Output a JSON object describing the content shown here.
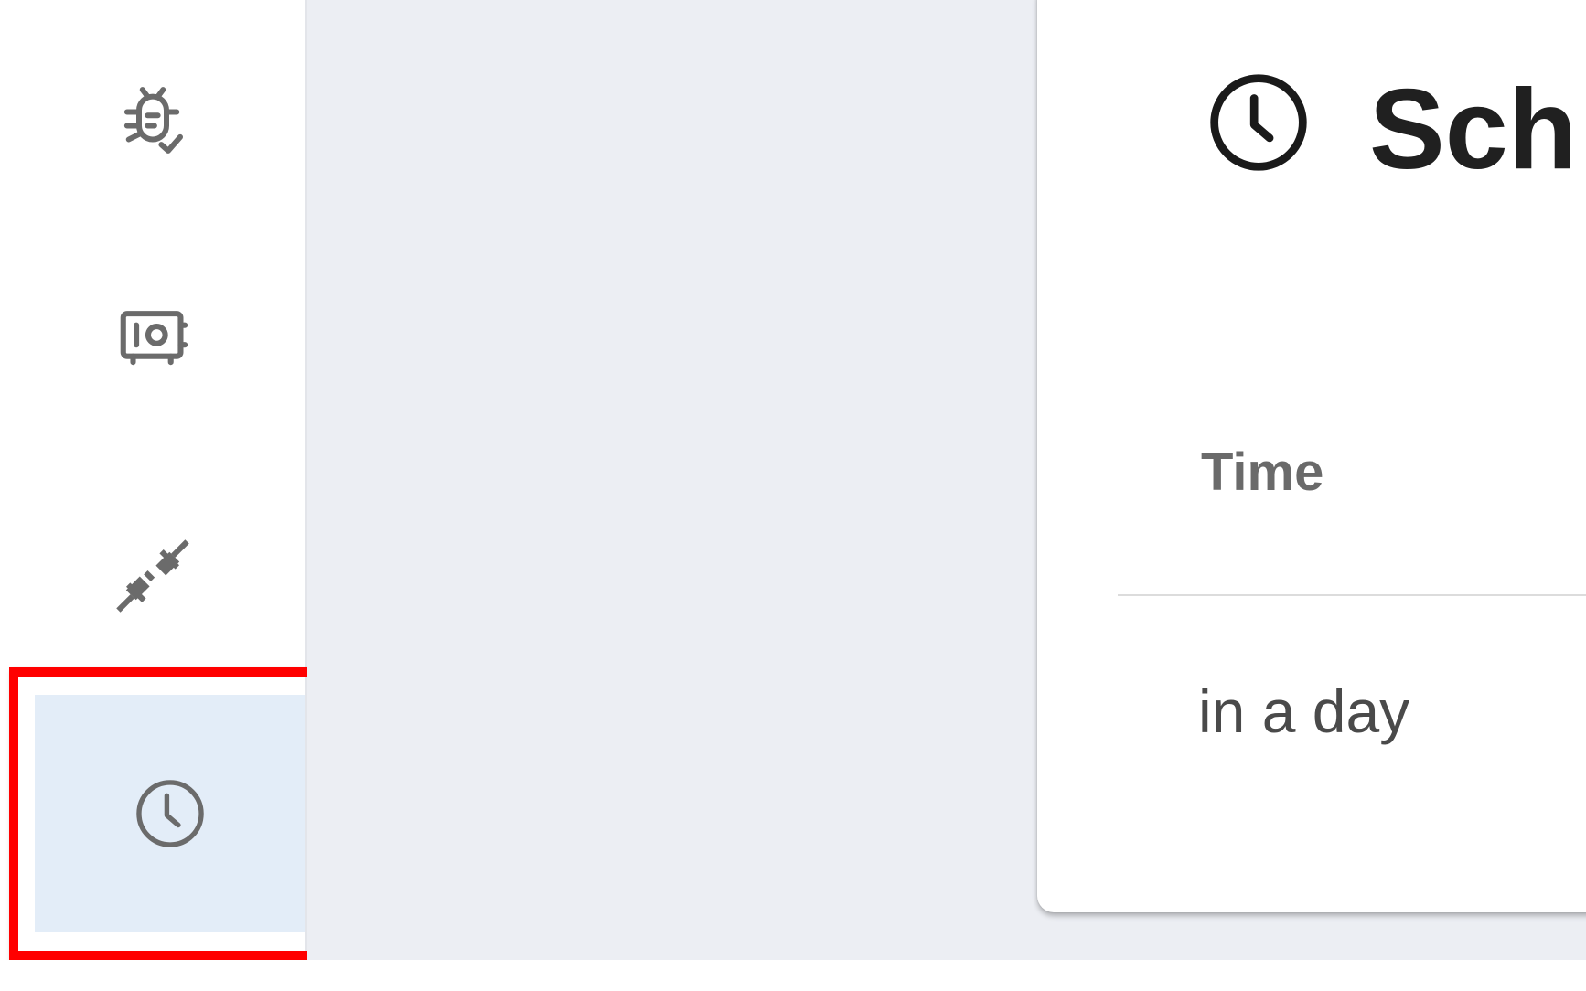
{
  "sidebar": {
    "items": [
      {
        "icon": "bug-check-icon",
        "selected": false
      },
      {
        "icon": "safe-icon",
        "selected": false
      },
      {
        "icon": "plug-icon",
        "selected": false
      },
      {
        "icon": "clock-icon",
        "selected": true
      }
    ]
  },
  "card": {
    "title": "Sch",
    "title_icon": "clock-icon",
    "table": {
      "header": "Time",
      "rows": [
        "in a day"
      ]
    }
  },
  "colors": {
    "icon_gray": "#6b6b6b",
    "selected_bg": "#e3edf8",
    "highlight": "#ff0000",
    "main_bg": "#eceef3"
  }
}
